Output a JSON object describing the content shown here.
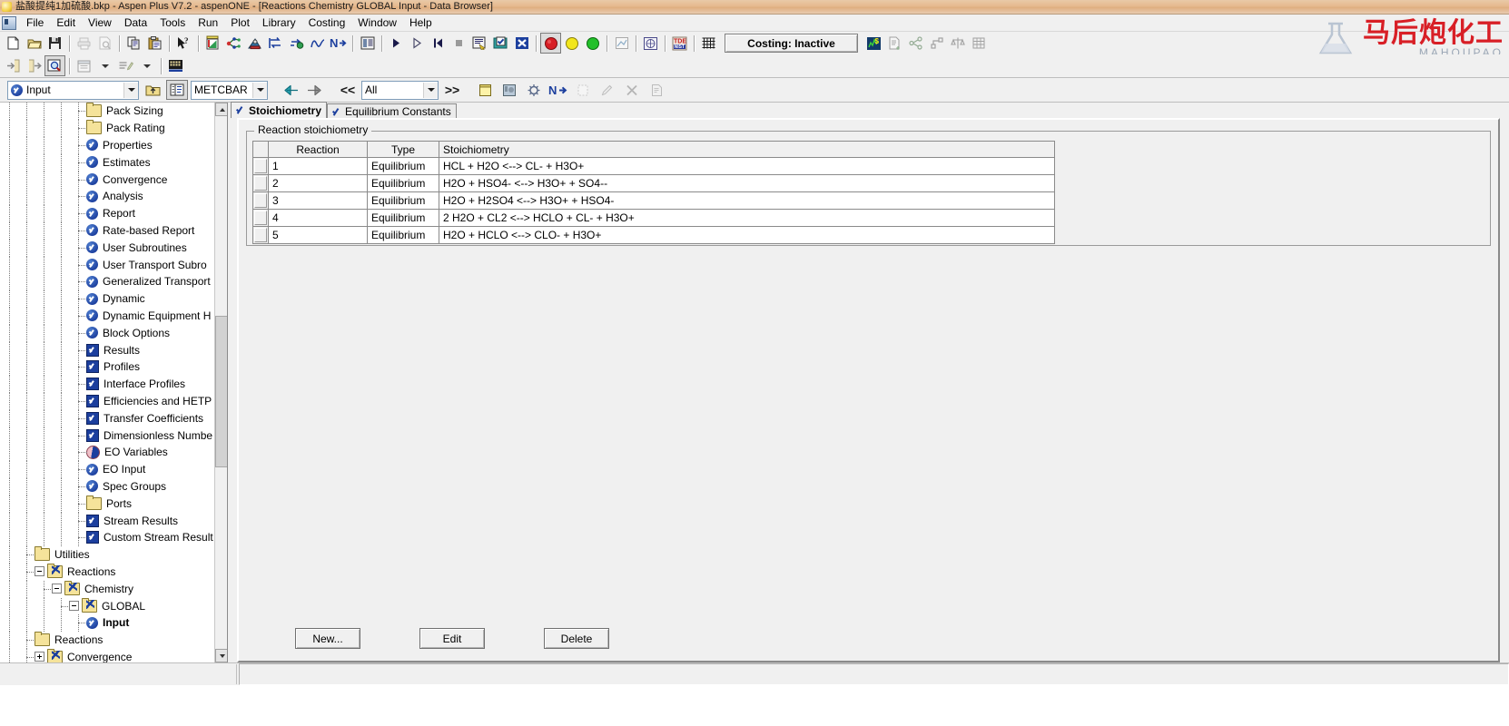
{
  "window": {
    "title": "盐酸提纯1加硫酸.bkp - Aspen Plus V7.2 - aspenONE - [Reactions Chemistry GLOBAL Input - Data Browser]",
    "app_icon": "aspen-logo-icon"
  },
  "menu": {
    "system_icon": "system-menu-icon",
    "items": [
      {
        "label": "File"
      },
      {
        "label": "Edit"
      },
      {
        "label": "View"
      },
      {
        "label": "Data"
      },
      {
        "label": "Tools"
      },
      {
        "label": "Run"
      },
      {
        "label": "Plot"
      },
      {
        "label": "Library"
      },
      {
        "label": "Costing"
      },
      {
        "label": "Window"
      },
      {
        "label": "Help"
      }
    ]
  },
  "toolbar_main": {
    "groups": [
      [
        "new-file-icon",
        "open-folder-icon",
        "save-icon"
      ],
      [
        "print-icon",
        "print-preview-icon"
      ],
      [
        "copy-icon",
        "paste-icon"
      ],
      [
        "help-pointer-icon"
      ],
      [
        "properties-chart-icon",
        "flowsheet-icon",
        "data-regression-icon",
        "reverse-flow-icon",
        "reactions-icon",
        "analysis-curve-icon",
        "next-input-icon"
      ],
      [
        "report-table-icon"
      ],
      [
        "run-icon",
        "step-icon",
        "reinitialize-icon",
        "stop-icon",
        "control-panel-icon",
        "check-results-icon",
        "excel-export-icon"
      ],
      [
        "status-red-icon",
        "status-yellow-icon",
        "status-green-icon"
      ],
      [
        "model-analysis-icon"
      ],
      [
        "optimization-icon"
      ],
      [
        "nist-tde-icon"
      ],
      [
        "grid-icon"
      ]
    ],
    "costing_status": "Costing: Inactive",
    "right_icons": [
      "economics-activate-icon",
      "economics-report-icon",
      "share-icon",
      "map-icon",
      "compare-icon",
      "exchanger-icon"
    ]
  },
  "toolbar_second": {
    "icons": [
      "import-icon",
      "export-icon",
      "zoom-find-icon",
      "form-view-icon",
      "form-view-dropdown-icon",
      "annotate-icon",
      "annotate-dropdown-icon",
      "tde-browser-icon"
    ]
  },
  "databrowser_bar": {
    "current_form": "Input",
    "current_form_icon": "blue-check-circle-icon",
    "up_one_level_icon": "up-level-icon",
    "toggle_tree_icon": "toggle-tree-icon",
    "units_set": "METCBAR",
    "back_icon": "back-arrow-icon",
    "forward_icon": "forward-arrow-icon",
    "prev_sheet_label": "<<",
    "filter": "All",
    "next_sheet_label": ">>",
    "icons": [
      "notes-icon",
      "find-icon",
      "settings-gear-icon",
      "next-input-n-icon",
      "new-object-icon",
      "rename-icon",
      "delete-x-icon",
      "clipboard-icon"
    ]
  },
  "tree": {
    "nodes": [
      {
        "label": "Pack Sizing",
        "icon": "folder-icon",
        "indent": 5,
        "bold": false
      },
      {
        "label": "Pack Rating",
        "icon": "folder-icon",
        "indent": 5,
        "bold": false
      },
      {
        "label": "Properties",
        "icon": "blue-check-circle-icon",
        "indent": 5,
        "bold": false
      },
      {
        "label": "Estimates",
        "icon": "blue-check-circle-icon",
        "indent": 5,
        "bold": false
      },
      {
        "label": "Convergence",
        "icon": "blue-check-circle-icon",
        "indent": 5,
        "bold": false
      },
      {
        "label": "Analysis",
        "icon": "blue-check-circle-icon",
        "indent": 5,
        "bold": false
      },
      {
        "label": "Report",
        "icon": "blue-check-circle-icon",
        "indent": 5,
        "bold": false
      },
      {
        "label": "Rate-based Report",
        "icon": "blue-check-circle-icon",
        "indent": 5,
        "bold": false
      },
      {
        "label": "User Subroutines",
        "icon": "blue-check-circle-icon",
        "indent": 5,
        "bold": false
      },
      {
        "label": "User Transport Subro",
        "icon": "blue-check-circle-icon",
        "indent": 5,
        "bold": false
      },
      {
        "label": "Generalized Transport",
        "icon": "blue-check-circle-icon",
        "indent": 5,
        "bold": false
      },
      {
        "label": "Dynamic",
        "icon": "blue-check-circle-icon",
        "indent": 5,
        "bold": false
      },
      {
        "label": "Dynamic Equipment H",
        "icon": "blue-check-circle-icon",
        "indent": 5,
        "bold": false
      },
      {
        "label": "Block Options",
        "icon": "blue-check-circle-icon",
        "indent": 5,
        "bold": false
      },
      {
        "label": "Results",
        "icon": "blue-check-square-icon",
        "indent": 5,
        "bold": false
      },
      {
        "label": "Profiles",
        "icon": "blue-check-square-icon",
        "indent": 5,
        "bold": false
      },
      {
        "label": "Interface Profiles",
        "icon": "blue-check-square-icon",
        "indent": 5,
        "bold": false
      },
      {
        "label": "Efficiencies and HETP",
        "icon": "blue-check-square-icon",
        "indent": 5,
        "bold": false
      },
      {
        "label": "Transfer Coefficients",
        "icon": "blue-check-square-icon",
        "indent": 5,
        "bold": false
      },
      {
        "label": "Dimensionless Numbe",
        "icon": "blue-check-square-icon",
        "indent": 5,
        "bold": false
      },
      {
        "label": "EO Variables",
        "icon": "eo-variables-icon",
        "indent": 5,
        "bold": false
      },
      {
        "label": "EO Input",
        "icon": "blue-check-circle-icon",
        "indent": 5,
        "bold": false
      },
      {
        "label": "Spec Groups",
        "icon": "blue-check-circle-icon",
        "indent": 5,
        "bold": false
      },
      {
        "label": "Ports",
        "icon": "folder-icon",
        "indent": 5,
        "bold": false
      },
      {
        "label": "Stream Results",
        "icon": "blue-check-square-icon",
        "indent": 5,
        "bold": false
      },
      {
        "label": "Custom Stream Result",
        "icon": "blue-check-square-icon",
        "indent": 5,
        "bold": false
      },
      {
        "label": "Utilities",
        "icon": "folder-icon",
        "indent": 2,
        "bold": false
      },
      {
        "label": "Reactions",
        "icon": "folder-check-icon",
        "indent": 2,
        "bold": false,
        "expander": "minus"
      },
      {
        "label": "Chemistry",
        "icon": "folder-check-icon",
        "indent": 3,
        "bold": false,
        "expander": "minus"
      },
      {
        "label": "GLOBAL",
        "icon": "folder-check-icon",
        "indent": 4,
        "bold": false,
        "expander": "minus"
      },
      {
        "label": "Input",
        "icon": "blue-check-circle-icon",
        "indent": 5,
        "bold": true
      },
      {
        "label": "Reactions",
        "icon": "folder-icon",
        "indent": 2,
        "bold": false
      },
      {
        "label": "Convergence",
        "icon": "folder-check-icon",
        "indent": 2,
        "bold": false,
        "expander": "plus"
      }
    ]
  },
  "tabs": [
    {
      "label": "Stoichiometry",
      "active": true,
      "icon": "blue-check-icon"
    },
    {
      "label": "Equilibrium Constants",
      "active": false,
      "icon": "blue-check-icon"
    }
  ],
  "form": {
    "group_title": "Reaction stoichiometry",
    "table": {
      "columns": [
        "",
        "Reaction",
        "Type",
        "Stoichiometry"
      ],
      "rows": [
        {
          "reaction": "1",
          "type": "Equilibrium",
          "stoichiometry": "HCL + H2O  <-->  CL- + H3O+"
        },
        {
          "reaction": "2",
          "type": "Equilibrium",
          "stoichiometry": "H2O + HSO4-  <-->  H3O+ + SO4--"
        },
        {
          "reaction": "3",
          "type": "Equilibrium",
          "stoichiometry": "H2O + H2SO4 <-->  H3O+ + HSO4-"
        },
        {
          "reaction": "4",
          "type": "Equilibrium",
          "stoichiometry": "2 H2O  + CL2 <-->  HCLO  + CL- + H3O+"
        },
        {
          "reaction": "5",
          "type": "Equilibrium",
          "stoichiometry": "H2O + HCLO  <-->  CLO- + H3O+"
        }
      ]
    },
    "buttons": [
      {
        "label": "New...",
        "name": "new-button"
      },
      {
        "label": "Edit",
        "name": "edit-button"
      },
      {
        "label": "Delete",
        "name": "delete-button"
      }
    ]
  },
  "watermark": {
    "cn": "马后炮化工",
    "en": "MAHOUPAO"
  },
  "colors": {
    "title_bar": "#e6b98e",
    "chrome": "#f0f0f0",
    "accent_blue": "#1c3f9e",
    "status_red": "#d81f26",
    "status_yellow": "#f2e61c",
    "status_green": "#22c02a"
  }
}
